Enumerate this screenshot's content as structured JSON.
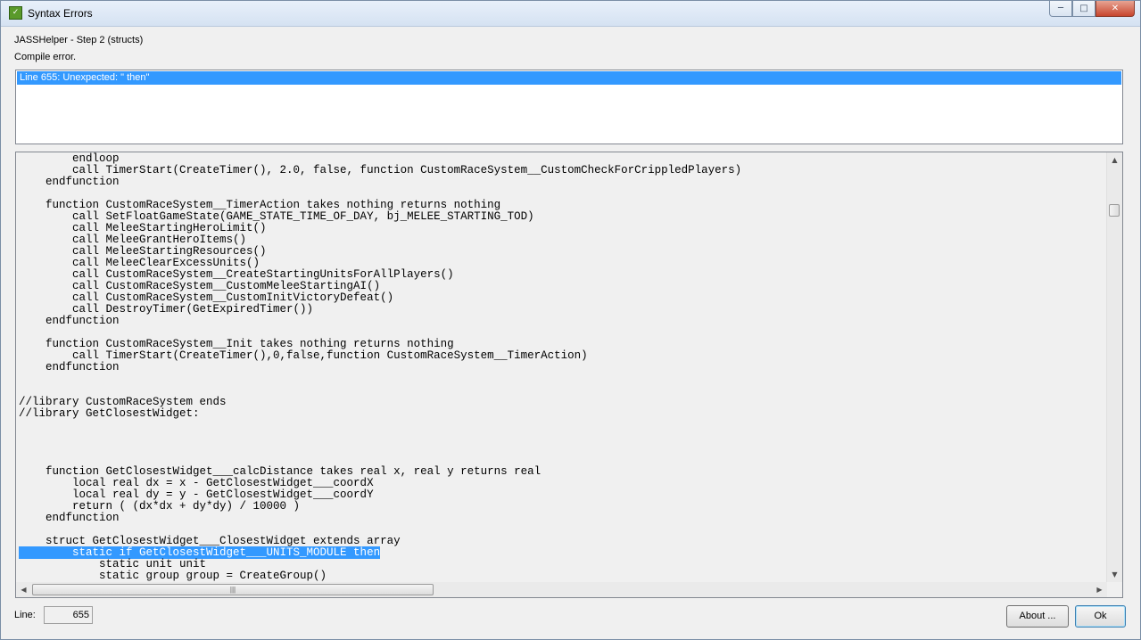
{
  "window": {
    "title": "Syntax Errors",
    "icon": "app-icon",
    "icon_glyph": "✓"
  },
  "header": {
    "step": "JASSHelper - Step 2 (structs)",
    "status": "Compile error."
  },
  "errors": [
    {
      "text": "Line 655: Unexpected: \" then\""
    }
  ],
  "code": {
    "lines": [
      "        endloop",
      "        call TimerStart(CreateTimer(), 2.0, false, function CustomRaceSystem__CustomCheckForCrippledPlayers)",
      "    endfunction",
      "",
      "    function CustomRaceSystem__TimerAction takes nothing returns nothing",
      "        call SetFloatGameState(GAME_STATE_TIME_OF_DAY, bj_MELEE_STARTING_TOD)",
      "        call MeleeStartingHeroLimit()",
      "        call MeleeGrantHeroItems()",
      "        call MeleeStartingResources()",
      "        call MeleeClearExcessUnits()",
      "        call CustomRaceSystem__CreateStartingUnitsForAllPlayers()",
      "        call CustomRaceSystem__CustomMeleeStartingAI()",
      "        call CustomRaceSystem__CustomInitVictoryDefeat()",
      "        call DestroyTimer(GetExpiredTimer())",
      "    endfunction",
      "",
      "    function CustomRaceSystem__Init takes nothing returns nothing",
      "        call TimerStart(CreateTimer(),0,false,function CustomRaceSystem__TimerAction)",
      "    endfunction",
      "",
      "",
      "//library CustomRaceSystem ends",
      "//library GetClosestWidget:",
      "",
      "",
      "",
      "",
      "    function GetClosestWidget___calcDistance takes real x, real y returns real",
      "        local real dx = x - GetClosestWidget___coordX",
      "        local real dy = y - GetClosestWidget___coordY",
      "        return ( (dx*dx + dy*dy) / 10000 )",
      "    endfunction",
      "",
      "    struct GetClosestWidget___ClosestWidget extends array",
      "        static if GetClosestWidget___UNITS_MODULE then",
      "            static unit unit",
      "            static group group = CreateGroup()"
    ],
    "highlighted_line_index": 34
  },
  "footer": {
    "line_label": "Line:",
    "line_value": "655",
    "about_label": "About ...",
    "ok_label": "Ok"
  },
  "caption_buttons": {
    "minimize": "─",
    "maximize": "□",
    "close": "✕"
  },
  "scroll_glyphs": {
    "up": "▲",
    "down": "▼",
    "left": "◀",
    "right": "▶",
    "grip": "|||"
  }
}
